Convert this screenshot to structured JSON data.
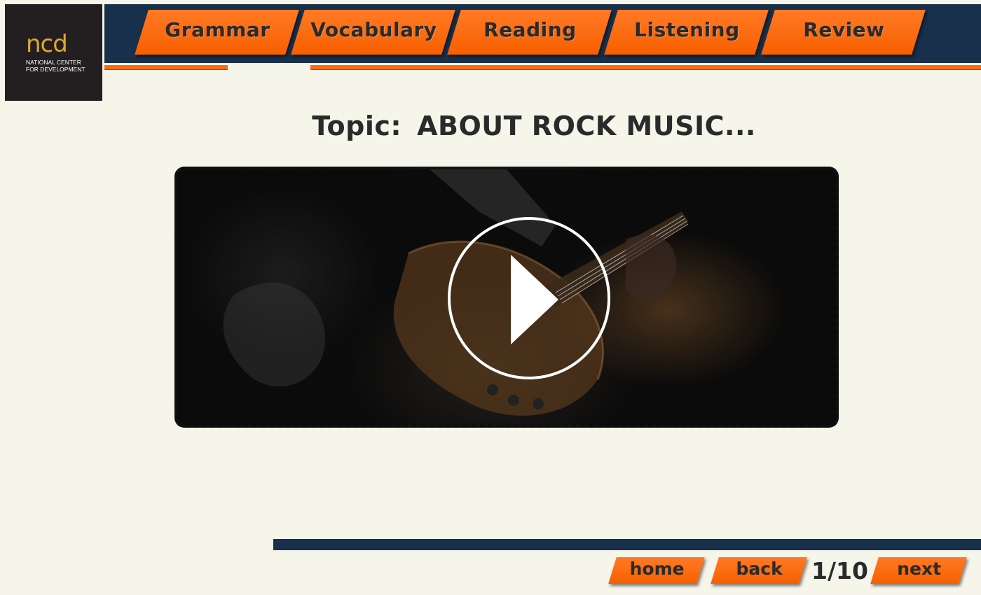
{
  "logo": {
    "mark": "ncd",
    "sub_line1": "NATIONAL CENTER",
    "sub_line2": "FOR DEVELOPMENT"
  },
  "tabs": [
    {
      "label": "Grammar"
    },
    {
      "label": "Vocabulary"
    },
    {
      "label": "Reading"
    },
    {
      "label": "Listening"
    },
    {
      "label": "Review"
    }
  ],
  "topic": {
    "prefix": "Topic:",
    "title": "ABOUT ROCK MUSIC..."
  },
  "video": {
    "play_icon": "play-icon",
    "thumbnail": "bass-guitar-player"
  },
  "footer": {
    "home_label": "home",
    "back_label": "back",
    "page_indicator": "1/10",
    "next_label": "next"
  },
  "colors": {
    "accent": "#f85f00",
    "navy": "#18304c",
    "background": "#f5f5ea",
    "text": "#2a2a2a"
  }
}
